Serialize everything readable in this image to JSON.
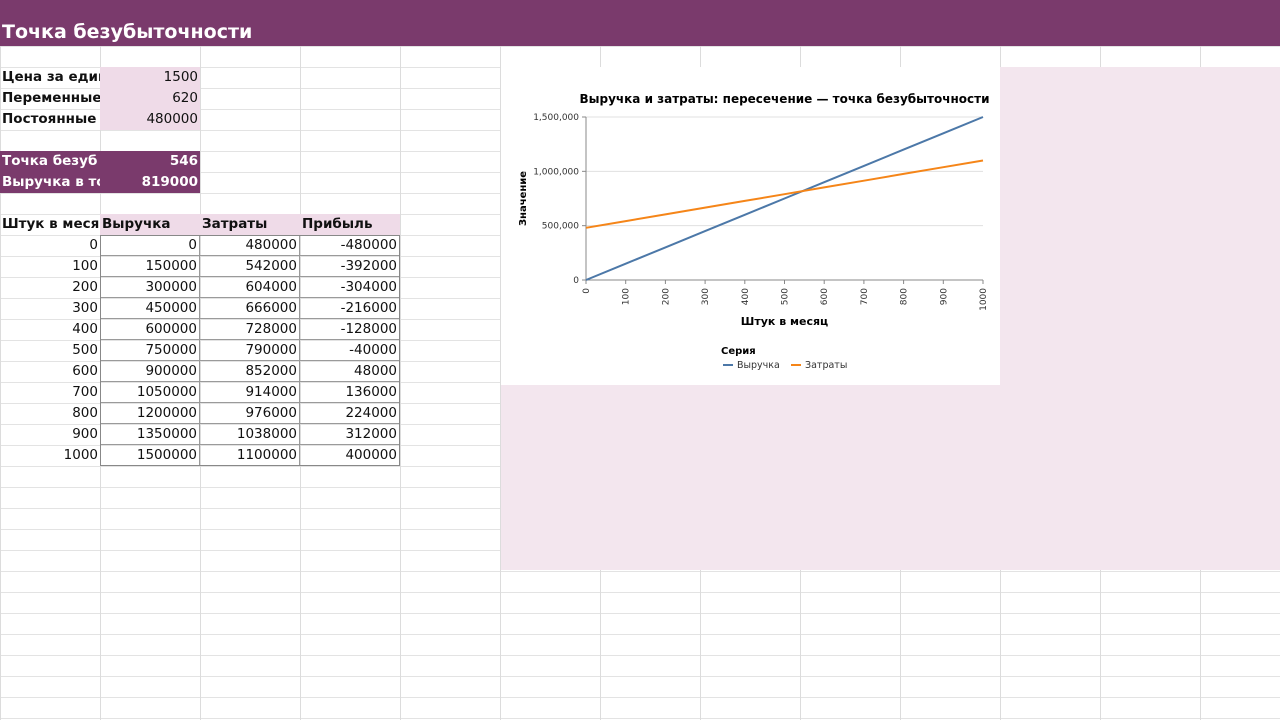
{
  "header": {
    "title": "Точка безубыточности"
  },
  "inputs": [
    {
      "label": "Цена за един",
      "value": "1500"
    },
    {
      "label": "Переменные",
      "value": "620"
    },
    {
      "label": "Постоянные",
      "value": "480000"
    }
  ],
  "results": [
    {
      "label": "Точка безуб",
      "value": "546"
    },
    {
      "label": "Выручка в то",
      "value": "819000"
    }
  ],
  "table": {
    "headers": [
      "Штук в меся",
      "Выручка",
      "Затраты",
      "Прибыль"
    ],
    "rows": [
      [
        "0",
        "0",
        "480000",
        "-480000"
      ],
      [
        "100",
        "150000",
        "542000",
        "-392000"
      ],
      [
        "200",
        "300000",
        "604000",
        "-304000"
      ],
      [
        "300",
        "450000",
        "666000",
        "-216000"
      ],
      [
        "400",
        "600000",
        "728000",
        "-128000"
      ],
      [
        "500",
        "750000",
        "790000",
        "-40000"
      ],
      [
        "600",
        "900000",
        "852000",
        "48000"
      ],
      [
        "700",
        "1050000",
        "914000",
        "136000"
      ],
      [
        "800",
        "1200000",
        "976000",
        "224000"
      ],
      [
        "900",
        "1350000",
        "1038000",
        "312000"
      ],
      [
        "1000",
        "1500000",
        "1100000",
        "400000"
      ]
    ]
  },
  "colors": {
    "header": "#7a3a6c",
    "accent_pink": "#efdbe8",
    "revenue_line": "#4c78a8",
    "cost_line": "#f58518"
  },
  "chart_data": {
    "type": "line",
    "title": "Выручка и затраты: пересечение — точка безубыточности",
    "xlabel": "Штук в месяц",
    "ylabel": "Значение",
    "x": [
      0,
      100,
      200,
      300,
      400,
      500,
      600,
      700,
      800,
      900,
      1000
    ],
    "x_ticks": [
      "0",
      "100",
      "200",
      "300",
      "400",
      "500",
      "600",
      "700",
      "800",
      "900",
      "1000"
    ],
    "y_ticks": [
      "0",
      "500,000",
      "1,000,000",
      "1,500,000"
    ],
    "y_tick_values": [
      0,
      500000,
      1000000,
      1500000
    ],
    "ylim": [
      0,
      1500000
    ],
    "xlim": [
      0,
      1000
    ],
    "legend_title": "Серия",
    "legend_position": "bottom",
    "grid": true,
    "series": [
      {
        "name": "Выручка",
        "color": "#4c78a8",
        "values": [
          0,
          150000,
          300000,
          450000,
          600000,
          750000,
          900000,
          1050000,
          1200000,
          1350000,
          1500000
        ]
      },
      {
        "name": "Затраты",
        "color": "#f58518",
        "values": [
          480000,
          542000,
          604000,
          666000,
          728000,
          790000,
          852000,
          914000,
          976000,
          1038000,
          1100000
        ]
      }
    ]
  }
}
